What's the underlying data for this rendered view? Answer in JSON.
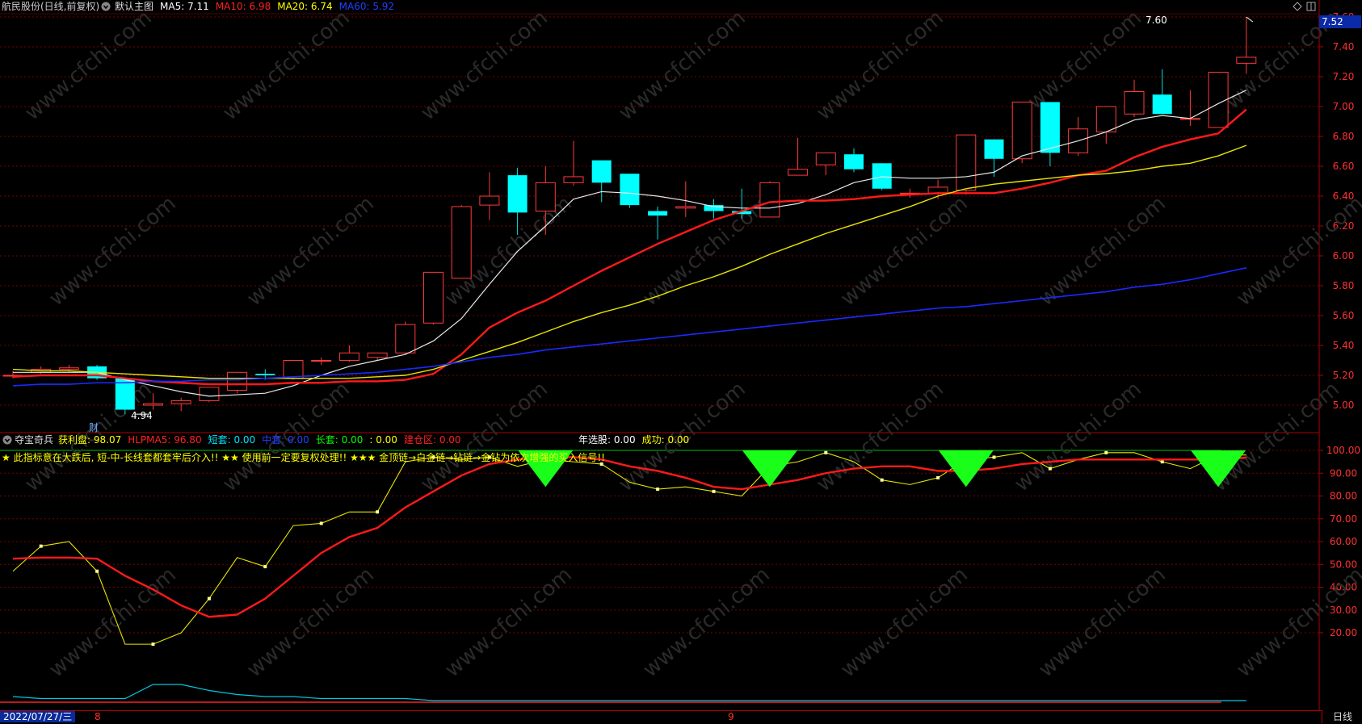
{
  "main_panel": {
    "stock": "航民股份(日线,前复权)",
    "template": "默认主图",
    "ma": [
      {
        "label": "MA5:",
        "value": "7.11",
        "color": "#ffffff"
      },
      {
        "label": "MA10:",
        "value": "6.98",
        "color": "#ff2020"
      },
      {
        "label": "MA20:",
        "value": "6.74",
        "color": "#ffff00"
      },
      {
        "label": "MA60:",
        "value": "5.92",
        "color": "#2040ff"
      }
    ],
    "high_marker": "7.60",
    "low_marker": "4.94",
    "fin_badge": "财",
    "last_price": "7.52",
    "y_ticks": [
      "7.60",
      "7.40",
      "7.20",
      "7.00",
      "6.80",
      "6.60",
      "6.40",
      "6.20",
      "6.00",
      "5.80",
      "5.60",
      "5.40",
      "5.20",
      "5.00"
    ]
  },
  "sub_panel": {
    "name": "夺宝奇兵",
    "fields": [
      {
        "label": "获利盘:",
        "value": "98.07",
        "color": "#ffff00"
      },
      {
        "label": "HLPMA5:",
        "value": "96.80",
        "color": "#ff2020"
      },
      {
        "label": "短套:",
        "value": "0.00",
        "color": "#00e5ff"
      },
      {
        "label": "中套:",
        "value": "0.00",
        "color": "#2040ff"
      },
      {
        "label": "长套:",
        "value": "0.00",
        "color": "#00ff00"
      },
      {
        "label": ":",
        "value": "0.00",
        "color": "#ffff00"
      },
      {
        "label": "建仓区:",
        "value": "0.00",
        "color": "#ff2020"
      }
    ],
    "extra": [
      {
        "label": "年选股:",
        "value": "0.00",
        "color": "#ffffff"
      },
      {
        "label": "成功:",
        "value": "0.00",
        "color": "#ffff00"
      }
    ],
    "notice": "★ 此指标意在大跌后, 短-中-长线套都套牢后介入!!    ★★ 使用前一定要复权处理!!    ★★★ 金顶链→白金链→钻链→金钻为依次增强的买入信号!!",
    "y_ticks": [
      "100.00",
      "90.00",
      "80.00",
      "70.00",
      "60.00",
      "50.00",
      "40.00",
      "30.00",
      "20.00"
    ]
  },
  "status": {
    "date": "2022/07/27/三",
    "month_marks": [
      "8",
      "9"
    ],
    "period": "日线"
  },
  "watermark": "www.cfchi.com",
  "chart_data": [
    {
      "type": "candlestick",
      "title": "航民股份(日线,前复权)",
      "ylim": [
        4.85,
        7.65
      ],
      "candles": [
        {
          "o": 5.2,
          "h": 5.23,
          "l": 5.18,
          "c": 5.2
        },
        {
          "o": 5.22,
          "h": 5.26,
          "l": 5.21,
          "c": 5.24
        },
        {
          "o": 5.24,
          "h": 5.27,
          "l": 5.22,
          "c": 5.25
        },
        {
          "o": 5.26,
          "h": 5.27,
          "l": 5.17,
          "c": 5.18
        },
        {
          "o": 5.18,
          "h": 5.18,
          "l": 4.94,
          "c": 4.97
        },
        {
          "o": 5.0,
          "h": 5.08,
          "l": 4.97,
          "c": 5.01
        },
        {
          "o": 5.01,
          "h": 5.05,
          "l": 4.96,
          "c": 5.03
        },
        {
          "o": 5.03,
          "h": 5.12,
          "l": 5.02,
          "c": 5.12
        },
        {
          "o": 5.1,
          "h": 5.22,
          "l": 5.08,
          "c": 5.22
        },
        {
          "o": 5.21,
          "h": 5.24,
          "l": 5.17,
          "c": 5.2
        },
        {
          "o": 5.18,
          "h": 5.3,
          "l": 5.17,
          "c": 5.3
        },
        {
          "o": 5.3,
          "h": 5.32,
          "l": 5.27,
          "c": 5.3
        },
        {
          "o": 5.3,
          "h": 5.4,
          "l": 5.29,
          "c": 5.35
        },
        {
          "o": 5.32,
          "h": 5.35,
          "l": 5.3,
          "c": 5.35
        },
        {
          "o": 5.35,
          "h": 5.56,
          "l": 5.34,
          "c": 5.54
        },
        {
          "o": 5.55,
          "h": 5.89,
          "l": 5.54,
          "c": 5.89
        },
        {
          "o": 5.85,
          "h": 6.34,
          "l": 5.85,
          "c": 6.33
        },
        {
          "o": 6.34,
          "h": 6.56,
          "l": 6.24,
          "c": 6.4
        },
        {
          "o": 6.54,
          "h": 6.59,
          "l": 6.14,
          "c": 6.29
        },
        {
          "o": 6.3,
          "h": 6.6,
          "l": 6.14,
          "c": 6.49
        },
        {
          "o": 6.49,
          "h": 6.77,
          "l": 6.47,
          "c": 6.53
        },
        {
          "o": 6.64,
          "h": 6.64,
          "l": 6.36,
          "c": 6.49
        },
        {
          "o": 6.55,
          "h": 6.55,
          "l": 6.32,
          "c": 6.34
        },
        {
          "o": 6.3,
          "h": 6.33,
          "l": 6.11,
          "c": 6.27
        },
        {
          "o": 6.32,
          "h": 6.5,
          "l": 6.26,
          "c": 6.33
        },
        {
          "o": 6.34,
          "h": 6.38,
          "l": 6.25,
          "c": 6.3
        },
        {
          "o": 6.3,
          "h": 6.45,
          "l": 6.25,
          "c": 6.28
        },
        {
          "o": 6.26,
          "h": 6.5,
          "l": 6.26,
          "c": 6.49
        },
        {
          "o": 6.54,
          "h": 6.79,
          "l": 6.54,
          "c": 6.58
        },
        {
          "o": 6.61,
          "h": 6.69,
          "l": 6.54,
          "c": 6.69
        },
        {
          "o": 6.68,
          "h": 6.72,
          "l": 6.56,
          "c": 6.58
        },
        {
          "o": 6.62,
          "h": 6.62,
          "l": 6.44,
          "c": 6.45
        },
        {
          "o": 6.42,
          "h": 6.45,
          "l": 6.39,
          "c": 6.42
        },
        {
          "o": 6.42,
          "h": 6.51,
          "l": 6.38,
          "c": 6.46
        },
        {
          "o": 6.44,
          "h": 6.81,
          "l": 6.41,
          "c": 6.81
        },
        {
          "o": 6.78,
          "h": 6.78,
          "l": 6.53,
          "c": 6.65
        },
        {
          "o": 6.65,
          "h": 7.03,
          "l": 6.62,
          "c": 7.03
        },
        {
          "o": 7.03,
          "h": 7.03,
          "l": 6.6,
          "c": 6.69
        },
        {
          "o": 6.69,
          "h": 6.93,
          "l": 6.67,
          "c": 6.85
        },
        {
          "o": 6.83,
          "h": 7.0,
          "l": 6.75,
          "c": 7.0
        },
        {
          "o": 6.95,
          "h": 7.18,
          "l": 6.93,
          "c": 7.1
        },
        {
          "o": 7.08,
          "h": 7.25,
          "l": 6.95,
          "c": 6.95
        },
        {
          "o": 6.92,
          "h": 7.11,
          "l": 6.87,
          "c": 6.92
        },
        {
          "o": 6.86,
          "h": 7.23,
          "l": 6.86,
          "c": 7.23
        },
        {
          "o": 7.29,
          "h": 7.6,
          "l": 7.22,
          "c": 7.33
        }
      ],
      "series": [
        {
          "name": "MA5",
          "values": [
            5.22,
            5.22,
            5.22,
            5.22,
            5.17,
            5.13,
            5.09,
            5.06,
            5.07,
            5.08,
            5.13,
            5.2,
            5.26,
            5.3,
            5.34,
            5.43,
            5.58,
            5.81,
            6.03,
            6.2,
            6.38,
            6.43,
            6.42,
            6.4,
            6.37,
            6.33,
            6.32,
            6.32,
            6.35,
            6.41,
            6.49,
            6.53,
            6.52,
            6.52,
            6.53,
            6.56,
            6.67,
            6.72,
            6.77,
            6.83,
            6.91,
            6.94,
            6.92,
            7.02,
            7.11
          ]
        },
        {
          "name": "MA10",
          "values": [
            5.19,
            5.2,
            5.2,
            5.2,
            5.18,
            5.16,
            5.15,
            5.14,
            5.14,
            5.14,
            5.15,
            5.15,
            5.16,
            5.16,
            5.17,
            5.21,
            5.34,
            5.52,
            5.62,
            5.7,
            5.8,
            5.9,
            5.99,
            6.08,
            6.16,
            6.24,
            6.3,
            6.36,
            6.37,
            6.37,
            6.38,
            6.4,
            6.41,
            6.42,
            6.42,
            6.42,
            6.45,
            6.49,
            6.54,
            6.57,
            6.66,
            6.73,
            6.78,
            6.82,
            6.98
          ]
        },
        {
          "name": "MA20",
          "values": [
            5.24,
            5.23,
            5.23,
            5.22,
            5.21,
            5.2,
            5.19,
            5.18,
            5.18,
            5.18,
            5.18,
            5.18,
            5.18,
            5.19,
            5.2,
            5.24,
            5.3,
            5.36,
            5.42,
            5.49,
            5.56,
            5.62,
            5.67,
            5.73,
            5.8,
            5.86,
            5.93,
            6.01,
            6.08,
            6.15,
            6.21,
            6.27,
            6.33,
            6.4,
            6.45,
            6.48,
            6.5,
            6.52,
            6.54,
            6.55,
            6.57,
            6.6,
            6.62,
            6.67,
            6.74
          ]
        },
        {
          "name": "MA60",
          "values": [
            5.13,
            5.14,
            5.14,
            5.15,
            5.15,
            5.16,
            5.16,
            5.17,
            5.17,
            5.18,
            5.19,
            5.2,
            5.21,
            5.22,
            5.24,
            5.26,
            5.29,
            5.32,
            5.34,
            5.37,
            5.39,
            5.41,
            5.43,
            5.45,
            5.47,
            5.49,
            5.51,
            5.53,
            5.55,
            5.57,
            5.59,
            5.61,
            5.63,
            5.65,
            5.66,
            5.68,
            5.7,
            5.72,
            5.74,
            5.76,
            5.79,
            5.81,
            5.84,
            5.88,
            5.92
          ]
        }
      ]
    },
    {
      "type": "line",
      "title": "夺宝奇兵",
      "ylim": [
        0,
        105
      ],
      "series": [
        {
          "name": "获利盘",
          "values": [
            47,
            58,
            60,
            47,
            15,
            15,
            20,
            35,
            53,
            49,
            67,
            68,
            73,
            73,
            95,
            97,
            96,
            97,
            93,
            96,
            95,
            94,
            86,
            83,
            84,
            82,
            80,
            93,
            95,
            99,
            95,
            87,
            85,
            88,
            96,
            97,
            99,
            92,
            96,
            99,
            99,
            95,
            92,
            98,
            98
          ]
        },
        {
          "name": "HLPMA5",
          "values": [
            52.5,
            53,
            53,
            52.5,
            45,
            39,
            32,
            27,
            28,
            35,
            45,
            55,
            62,
            66,
            75,
            82,
            89,
            94,
            96,
            97,
            97,
            96,
            93,
            91,
            88,
            84,
            83,
            85,
            87,
            90,
            92,
            93,
            93,
            91,
            91,
            92,
            94,
            95,
            96,
            96,
            96,
            96,
            96,
            96,
            96.8
          ]
        },
        {
          "name": "短套",
          "values": [
            2,
            1,
            1,
            1,
            1,
            8,
            8,
            5,
            3,
            2,
            2,
            1,
            1,
            1,
            1,
            0,
            0,
            0,
            0,
            0,
            0,
            0,
            0,
            0,
            0,
            0,
            0,
            0,
            0,
            0,
            0,
            0,
            0,
            0,
            0,
            0,
            0,
            0,
            0,
            0,
            0,
            0,
            0,
            0,
            0
          ]
        }
      ],
      "signals": [
        19,
        27,
        34,
        43
      ]
    }
  ]
}
